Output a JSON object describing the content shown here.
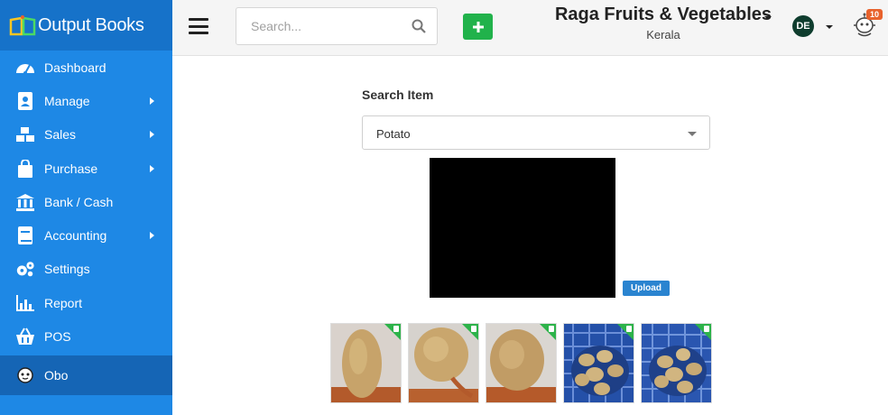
{
  "brand": {
    "name": "Output Books"
  },
  "sidebar": {
    "items": [
      {
        "label": "Dashboard",
        "icon": "dashboard-icon",
        "has_submenu": false
      },
      {
        "label": "Manage",
        "icon": "address-book-icon",
        "has_submenu": true
      },
      {
        "label": "Sales",
        "icon": "cubes-icon",
        "has_submenu": true
      },
      {
        "label": "Purchase",
        "icon": "shopping-bag-icon",
        "has_submenu": true
      },
      {
        "label": "Bank / Cash",
        "icon": "bank-icon",
        "has_submenu": false
      },
      {
        "label": "Accounting",
        "icon": "book-icon",
        "has_submenu": true
      },
      {
        "label": "Settings",
        "icon": "gears-icon",
        "has_submenu": false
      },
      {
        "label": "Report",
        "icon": "bar-chart-icon",
        "has_submenu": false
      },
      {
        "label": "POS",
        "icon": "basket-icon",
        "has_submenu": false
      },
      {
        "label": "Obo",
        "icon": "robot-icon",
        "has_submenu": false
      }
    ]
  },
  "topbar": {
    "search_placeholder": "Search...",
    "company_name": "Raga Fruits & Vegetables",
    "company_location": "Kerala",
    "user_initials": "DE",
    "notification_count": "10"
  },
  "main": {
    "search_item_label": "Search Item",
    "selected_item": "Potato",
    "upload_label": "Upload",
    "thumbnail_count": 5
  },
  "colors": {
    "sidebar": "#1e88e5",
    "brand_bar": "#1672c9",
    "add_button": "#21b24b",
    "upload_button": "#2a84d0",
    "badge": "#e8622c",
    "avatar": "#0f3d2e"
  }
}
